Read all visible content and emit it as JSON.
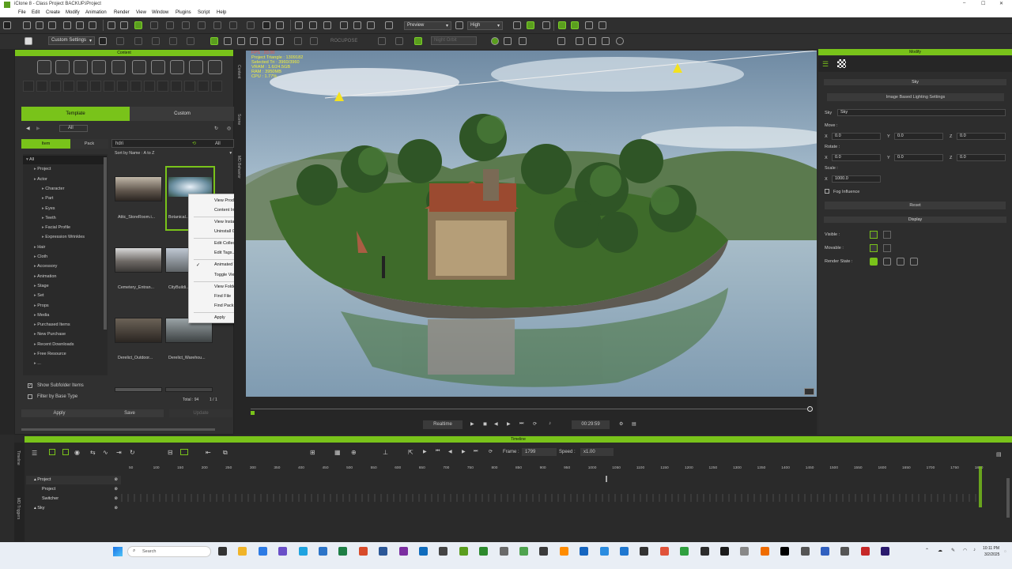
{
  "window": {
    "title": "iClone 8 - Class Project BACKUP.iProject",
    "min": "–",
    "max": "☐",
    "close": "✕"
  },
  "menu": [
    "File",
    "Edit",
    "Create",
    "Modify",
    "Animation",
    "Render",
    "View",
    "Window",
    "Plugins",
    "Script",
    "Help"
  ],
  "toolbar": {
    "preview_mode": "Preview",
    "quality": "High",
    "custom_settings": "Custom Settings",
    "rocupose": "ROCUPOSE",
    "night_orbit": "Night Orbit"
  },
  "content": {
    "panel_title": "Content",
    "tabs": {
      "template": "Template",
      "custom": "Custom"
    },
    "path": "All",
    "subtabs": {
      "item": "Item",
      "pack": "Pack"
    },
    "search": "hdri",
    "filter_all": "All",
    "sort": "Sort by Name : A to Z",
    "tree": [
      {
        "label": "All",
        "lvl": 0
      },
      {
        "label": "Project",
        "lvl": 1
      },
      {
        "label": "Actor",
        "lvl": 1
      },
      {
        "label": "Character",
        "lvl": 2
      },
      {
        "label": "Part",
        "lvl": 2
      },
      {
        "label": "Eyes",
        "lvl": 2
      },
      {
        "label": "Teeth",
        "lvl": 2
      },
      {
        "label": "Facial Profile",
        "lvl": 2
      },
      {
        "label": "Expression Wrinkles",
        "lvl": 2
      },
      {
        "label": "Hair",
        "lvl": 1
      },
      {
        "label": "Cloth",
        "lvl": 1
      },
      {
        "label": "Accessory",
        "lvl": 1
      },
      {
        "label": "Animation",
        "lvl": 1
      },
      {
        "label": "Stage",
        "lvl": 1
      },
      {
        "label": "Set",
        "lvl": 1
      },
      {
        "label": "Props",
        "lvl": 1
      },
      {
        "label": "Media",
        "lvl": 1
      },
      {
        "label": "Purchased Items",
        "lvl": 1
      },
      {
        "label": "New Purchase",
        "lvl": 1
      },
      {
        "label": "Recent Downloads",
        "lvl": 1
      },
      {
        "label": "Free Resource",
        "lvl": 1
      },
      {
        "label": "...",
        "lvl": 1
      }
    ],
    "items": [
      "Attic_StoreRoom.i...",
      "Botanical...",
      "Cemetery_Entran...",
      "CityBuildi...",
      "Derelict_Outdoor...",
      "Derelict_Warehou..."
    ],
    "show_subfolder": "Show Subfolder Items",
    "filter_base": "Filter by Base Type",
    "total": "Total : 94",
    "page": "1 / 1",
    "apply": "Apply",
    "save": "Save",
    "unused": "Update"
  },
  "context_menu": [
    "View Product Page",
    "Content Info",
    "View Installing List",
    "Uninstall Content",
    "Edit Collections...",
    "Edit Tags...",
    "Animated Thumbnail",
    "Toggle View",
    "View Folder",
    "Find File",
    "Find Pack",
    "Apply"
  ],
  "side_tabs": [
    "Content",
    "Scene",
    "MD Behavior"
  ],
  "stats": [
    "FPS : 20.00",
    "Project Triangle : 1309182",
    "Selected Tri : 3960/3960",
    "VRAM : 1.6/24.5GB",
    "RAM : 3950MB",
    "CPU : 1.77%"
  ],
  "playback": {
    "mode": "Realtime",
    "time": "00:29:59"
  },
  "modify": {
    "panel_title": "Modify",
    "section": "Sky",
    "ibl_button": "Image Based Lighting Settings",
    "sky_label": "Sky",
    "sky_value": "Sky",
    "move": "Move :",
    "rotate": "Rotate :",
    "scale": "Scale :",
    "x": "X",
    "y": "Y",
    "z": "Z",
    "zero": "0.0",
    "scale_value": "1000.0",
    "fog": "Fog Influence",
    "reset": "Reset",
    "display": "Display",
    "visible": "Visible :",
    "movable": "Movable :",
    "render_state": "Render State :"
  },
  "timeline": {
    "title": "Timeline",
    "frame_label": "Frame :",
    "frame": "1799",
    "speed_label": "Speed :",
    "speed": "x1.00",
    "ticks": [
      "50",
      "100",
      "150",
      "200",
      "250",
      "300",
      "350",
      "400",
      "450",
      "500",
      "550",
      "600",
      "650",
      "700",
      "750",
      "800",
      "850",
      "900",
      "950",
      "1000",
      "1050",
      "1100",
      "1150",
      "1200",
      "1250",
      "1300",
      "1350",
      "1400",
      "1450",
      "1500",
      "1550",
      "1600",
      "1650",
      "1700",
      "1750",
      "1800"
    ],
    "tracks": [
      {
        "label": "Project",
        "indent": 0
      },
      {
        "label": "Project",
        "indent": 1
      },
      {
        "label": "Switcher",
        "indent": 1
      },
      {
        "label": "Sky",
        "indent": 0
      }
    ],
    "side": [
      "Timeline",
      "MD Triggers"
    ]
  },
  "taskbar": {
    "search": "Search",
    "time": "10:11 PM",
    "date": "3/2/2025"
  }
}
